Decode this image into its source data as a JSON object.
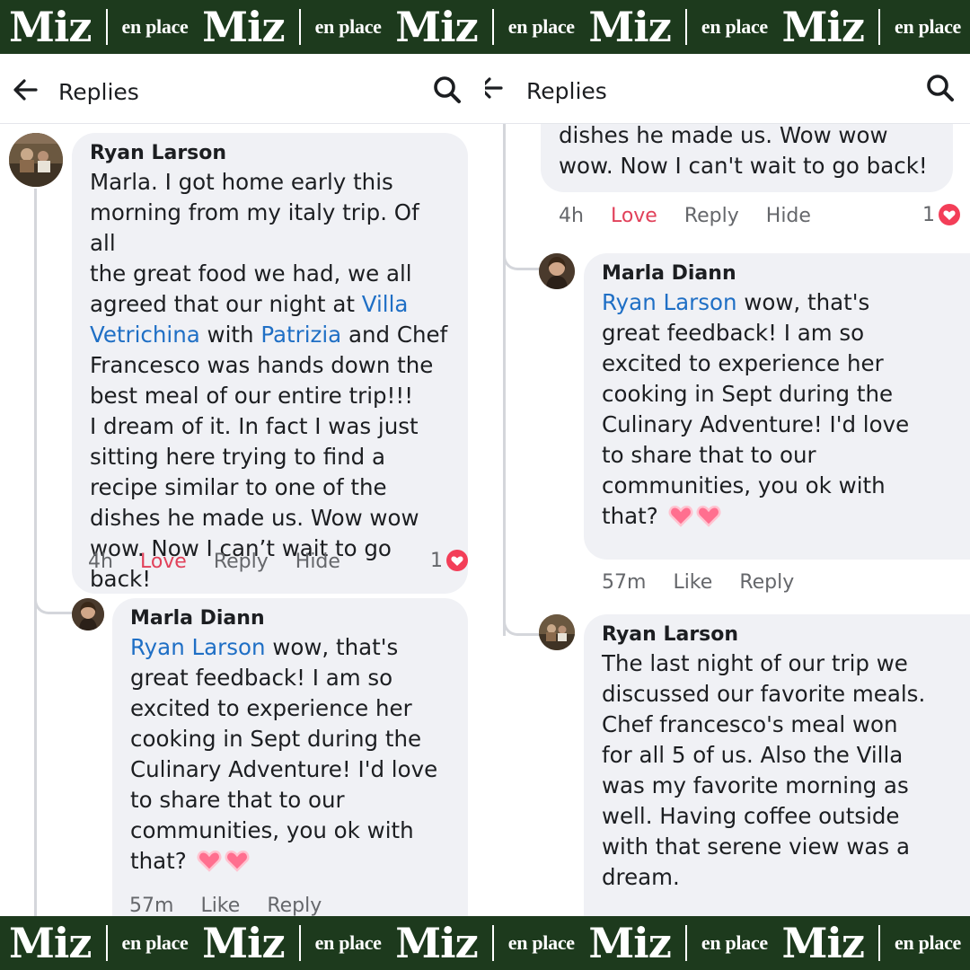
{
  "brand": {
    "logo": "Miz",
    "tagline": "en place",
    "bar_color": "#1d3a1d"
  },
  "appbar": {
    "title": "Replies",
    "back_icon": "arrow-left-icon",
    "search_icon": "search-icon"
  },
  "left": {
    "comment": {
      "author": "Ryan Larson",
      "text_1": "Marla. I got home early this\nmorning from my italy trip. Of all\nthe great food we had, we all\nagreed that our night at ",
      "mention_1": "Villa\nVetrichina",
      "text_2": " with ",
      "mention_2": "Patrizia",
      "text_3": " and Chef\nFrancesco was hands down the\nbest meal of our entire trip!!!\nI dream of it. In fact I was just\nsitting here trying to find a\nrecipe similar to one of the\ndishes he made us. Wow wow\nwow. Now I can’t wait to go back!",
      "time": "4h",
      "love": "Love",
      "reply": "Reply",
      "hide": "Hide",
      "reaction_count": "1"
    },
    "reply": {
      "author": "Marla Diann",
      "mention": "Ryan Larson",
      "text": " wow, that's\ngreat feedback! I am so\nexcited to experience her\ncooking in Sept during the\nCulinary Adventure! I'd love\nto share that to our\ncommunities, you ok with\nthat? ",
      "time": "57m",
      "like": "Like",
      "reply": "Reply"
    }
  },
  "right": {
    "comment_tail": {
      "text": "dishes he made us. Wow wow\nwow. Now I can't wait to go back!",
      "time": "4h",
      "love": "Love",
      "reply": "Reply",
      "hide": "Hide",
      "reaction_count": "1"
    },
    "reply_1": {
      "author": "Marla Diann",
      "mention": "Ryan Larson",
      "text": " wow, that's\ngreat feedback! I am so\nexcited to experience her\ncooking in Sept during the\nCulinary Adventure! I'd love\nto share that to our\ncommunities, you ok with\nthat? ",
      "time": "57m",
      "like": "Like",
      "reply": "Reply"
    },
    "reply_2": {
      "author": "Ryan Larson",
      "text": "The last night of our trip we\ndiscussed our favorite meals.\nChef francesco's meal won\nfor all 5 of us. Also the Villa\nwas my favorite morning as\nwell. Having coffee outside\nwith that serene view was a\ndream."
    }
  },
  "colors": {
    "bubble": "#f0f1f5",
    "mention": "#1f6fc5",
    "love": "#e1415a",
    "meta": "#65676b"
  }
}
